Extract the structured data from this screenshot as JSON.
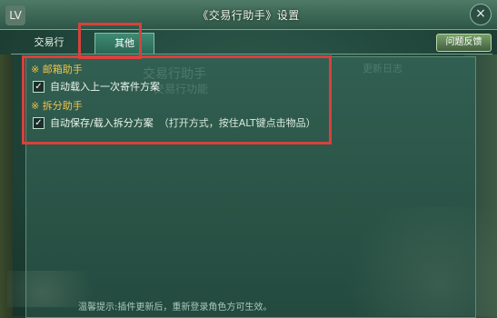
{
  "window": {
    "title": "《交易行助手》设置",
    "close_label": "×",
    "corner_label": "LV"
  },
  "tabs": [
    {
      "label": "交易行"
    },
    {
      "label": "其他"
    }
  ],
  "feedback_button": "问题反馈",
  "background": {
    "ghost_title": "交易行助手",
    "ghost_subtitle": "交易行功能",
    "ghost_update_log": "更新日志"
  },
  "sections": [
    {
      "title": "※ 邮箱助手",
      "options": [
        {
          "label": "自动载入上一次寄件方案",
          "checked": true,
          "hint": ""
        }
      ]
    },
    {
      "title": "※ 拆分助手",
      "options": [
        {
          "label": "自动保存/载入拆分方案",
          "checked": true,
          "hint": "（打开方式，按住ALT键点击物品）"
        }
      ]
    }
  ],
  "footer_text": "温馨提示:插件更新后，重新登录角色方可生效。",
  "colors": {
    "accent_red": "#d8413e",
    "section_yellow": "#f2c34a"
  }
}
